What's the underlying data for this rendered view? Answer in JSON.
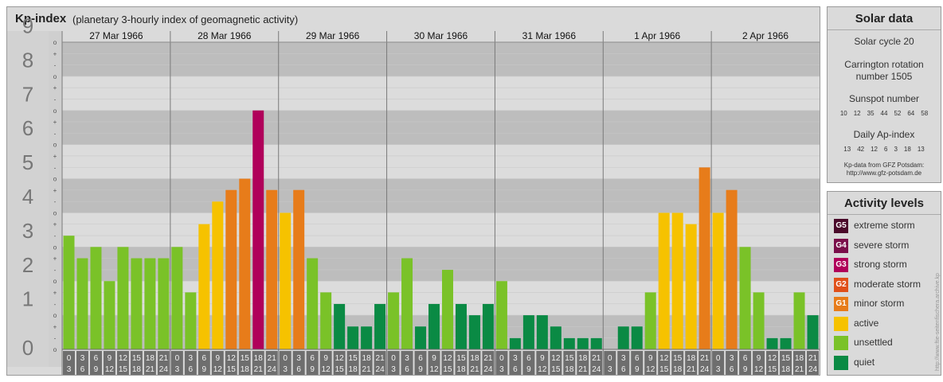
{
  "title": "Kp-index",
  "subtitle": "(planetary 3-hourly index of geomagnetic activity)",
  "solar": {
    "heading": "Solar data",
    "cycle": "Solar cycle 20",
    "carrington_line1": "Carrington rotation",
    "carrington_line2": "number 1505",
    "sunspot_label": "Sunspot number",
    "sunspots": [
      "10",
      "12",
      "35",
      "44",
      "52",
      "64",
      "58"
    ],
    "ap_label": "Daily Ap-index",
    "ap": [
      "13",
      "42",
      "12",
      "6",
      "3",
      "18",
      "13"
    ],
    "source_line1": "Kp-data from GFZ Potsdam:",
    "source_line2": "http://www.gfz-potsdam.de"
  },
  "activity": {
    "heading": "Activity levels",
    "levels": [
      {
        "code": "G5",
        "label": "extreme storm",
        "color": "#4a0a2a"
      },
      {
        "code": "G4",
        "label": "severe storm",
        "color": "#7a0f4a"
      },
      {
        "code": "G3",
        "label": "strong storm",
        "color": "#b0005a"
      },
      {
        "code": "G2",
        "label": "moderate storm",
        "color": "#e0501a"
      },
      {
        "code": "G1",
        "label": "minor storm",
        "color": "#e77c1a"
      },
      {
        "code": "",
        "label": "active",
        "color": "#f6c200"
      },
      {
        "code": "",
        "label": "unsettled",
        "color": "#7ac228"
      },
      {
        "code": "",
        "label": "quiet",
        "color": "#0a8a44"
      }
    ]
  },
  "credit": "http://www.ftie-seitenfischera.archive.kp",
  "chart_data": {
    "type": "bar",
    "ylim": [
      0,
      9
    ],
    "y_ticks": [
      "0",
      "1",
      "2",
      "3",
      "4",
      "5",
      "6",
      "7",
      "8",
      "9"
    ],
    "minor_marks": [
      "o",
      "-",
      "+",
      "o",
      "-",
      "+",
      "o",
      "-",
      "+",
      "o",
      "-",
      "+",
      "o",
      "-",
      "+",
      "o",
      "-",
      "+",
      "o",
      "-",
      "+",
      "o",
      "-",
      "+",
      "o",
      "-",
      "+",
      "o"
    ],
    "days": [
      "27 Mar 1966",
      "28 Mar 1966",
      "29 Mar 1966",
      "30 Mar 1966",
      "31 Mar 1966",
      "1 Apr 1966",
      "2 Apr 1966"
    ],
    "slot_start": [
      "0",
      "3",
      "6",
      "9",
      "12",
      "15",
      "18",
      "21"
    ],
    "slot_end": [
      "3",
      "6",
      "9",
      "12",
      "15",
      "18",
      "21",
      "24"
    ],
    "values": [
      3.33,
      2.67,
      3.0,
      2.0,
      3.0,
      2.67,
      2.67,
      2.67,
      3.0,
      1.67,
      3.67,
      4.33,
      4.67,
      5.0,
      7.0,
      4.67,
      4.0,
      4.67,
      2.67,
      1.67,
      1.33,
      0.67,
      0.67,
      1.33,
      1.67,
      2.67,
      0.67,
      1.33,
      2.33,
      1.33,
      1.0,
      1.33,
      2.0,
      0.33,
      1.0,
      1.0,
      0.67,
      0.33,
      0.33,
      0.33,
      0.0,
      0.67,
      0.67,
      1.67,
      4.0,
      4.0,
      3.67,
      5.33,
      4.0,
      4.67,
      3.0,
      1.67,
      0.33,
      0.33,
      1.67,
      1.0
    ],
    "colors": {
      "quiet": "#0a8a44",
      "unsettled": "#7ac228",
      "active": "#f6c200",
      "g1": "#e77c1a",
      "g2": "#e0501a",
      "g3": "#b0005a"
    }
  }
}
